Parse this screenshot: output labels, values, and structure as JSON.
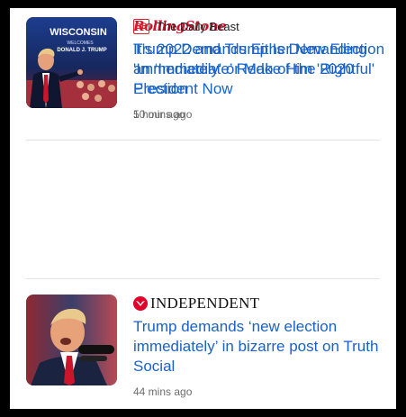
{
  "articles": [
    {
      "source": "RollingStone",
      "headline": "It’s 2022 and Trump Is Demanding an ‘Immediate’ Redo of the 2020 Election",
      "time": "1 hour ago",
      "thumbnail": "trump-portrait-photo"
    },
    {
      "source": "INDEPENDENT",
      "headline": "Trump demands ‘new election immediately’ in bizarre post on Truth Social",
      "time": "44 mins ago",
      "thumbnail": "trump-speaking-microphone-photo"
    },
    {
      "source": "The Daily Beast",
      "source_mark": "DB",
      "thumbnail_sign_lines": [
        "WISCONSIN",
        "WELCOMES",
        "DONALD J. TRUMP"
      ],
      "headline": "Trump Demands Either New Election 'Immediately' or Make Him 'Rightful' President Now",
      "time": "50 mins ago",
      "thumbnail": "trump-rally-wisconsin-photo"
    }
  ],
  "colors": {
    "headline": "#1a62c5",
    "time": "#6d6d6d",
    "rollingstone_red": "#d0112b",
    "independent_red": "#e0002a",
    "dailybeast_red": "#d4262a",
    "background": "#ffffff",
    "frame": "#000000"
  }
}
